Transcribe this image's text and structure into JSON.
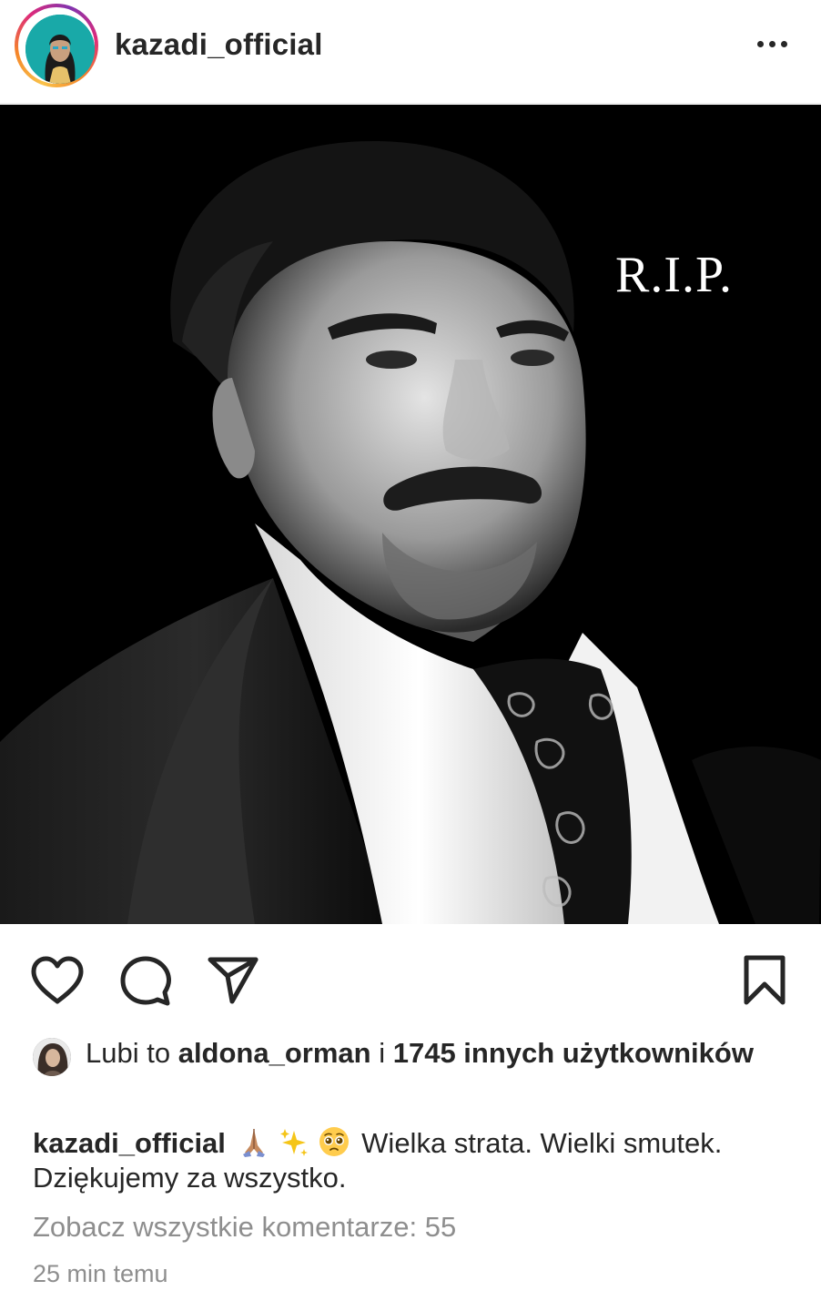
{
  "post": {
    "username": "kazadi_official",
    "more_icon": "more-horizontal-icon"
  },
  "photo": {
    "overlay_text": "R.I.P."
  },
  "actions": {
    "like_icon": "heart-icon",
    "comment_icon": "comment-icon",
    "share_icon": "send-icon",
    "save_icon": "bookmark-icon"
  },
  "likes": {
    "prefix": "Lubi to ",
    "user": "aldona_orman",
    "connector": " i ",
    "others": "1745 innych użytkowników"
  },
  "caption": {
    "user": "kazadi_official",
    "emojis": [
      "folded-hands-emoji",
      "sparkles-emoji",
      "pleading-face-emoji"
    ],
    "text": "Wielka strata. Wielki smutek. Dziękujemy za wszystko."
  },
  "comments": {
    "label": "Zobacz wszystkie komentarze: 55"
  },
  "timestamp": "25 min temu"
}
